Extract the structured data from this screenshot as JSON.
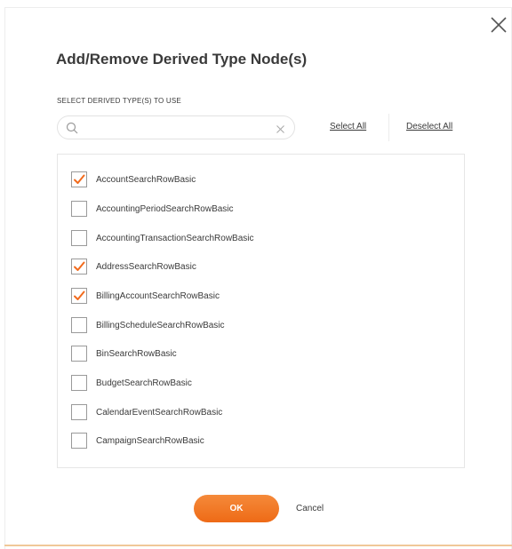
{
  "dialog": {
    "title": "Add/Remove Derived Type Node(s)",
    "section_label": "SELECT DERIVED TYPE(S) TO USE",
    "close_icon": "close-icon"
  },
  "search": {
    "placeholder": "",
    "value": "",
    "icon": "search-icon",
    "clear_icon": "clear-icon"
  },
  "actions": {
    "select_all": "Select All",
    "deselect_all": "Deselect All",
    "ok": "OK",
    "cancel": "Cancel"
  },
  "colors": {
    "accent": "#f26b1d",
    "checkmark": "#f26b1d"
  },
  "items": [
    {
      "label": "AccountSearchRowBasic",
      "checked": true
    },
    {
      "label": "AccountingPeriodSearchRowBasic",
      "checked": false
    },
    {
      "label": "AccountingTransactionSearchRowBasic",
      "checked": false
    },
    {
      "label": "AddressSearchRowBasic",
      "checked": true
    },
    {
      "label": "BillingAccountSearchRowBasic",
      "checked": true
    },
    {
      "label": "BillingScheduleSearchRowBasic",
      "checked": false
    },
    {
      "label": "BinSearchRowBasic",
      "checked": false
    },
    {
      "label": "BudgetSearchRowBasic",
      "checked": false
    },
    {
      "label": "CalendarEventSearchRowBasic",
      "checked": false
    },
    {
      "label": "CampaignSearchRowBasic",
      "checked": false
    }
  ]
}
